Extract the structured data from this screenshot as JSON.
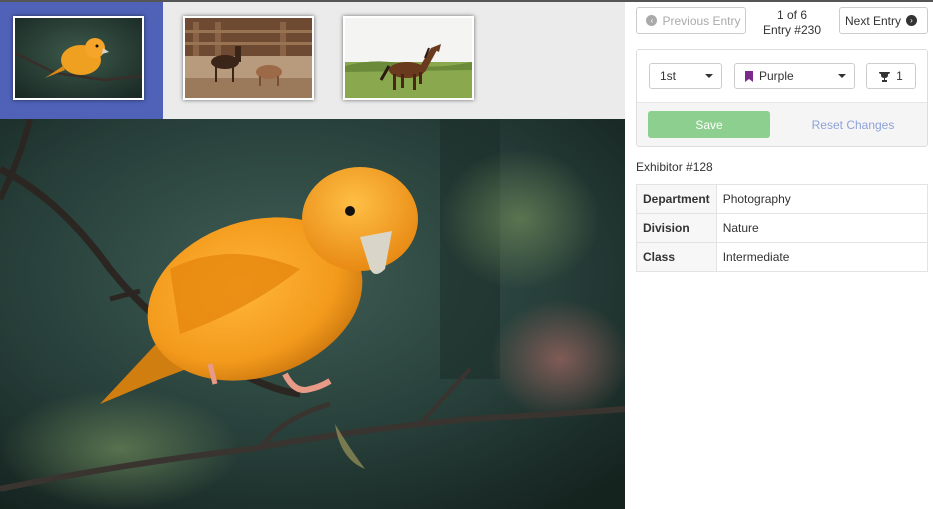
{
  "thumbnails": [
    {
      "name": "canary",
      "active": true
    },
    {
      "name": "foal-and-donkey",
      "active": false
    },
    {
      "name": "running-horse",
      "active": false
    }
  ],
  "nav": {
    "previous_label": "Previous Entry",
    "next_label": "Next Entry",
    "position": "1 of 6",
    "entry": "Entry #230"
  },
  "award": {
    "place": "1st",
    "ribbon": "Purple",
    "ribbon_color": "#7b2a8c",
    "trophy_count": "1",
    "save_label": "Save",
    "reset_label": "Reset Changes"
  },
  "exhibitor": "Exhibitor #128",
  "details": [
    {
      "label": "Department",
      "value": "Photography"
    },
    {
      "label": "Division",
      "value": "Nature"
    },
    {
      "label": "Class",
      "value": "Intermediate"
    }
  ],
  "colors": {
    "active_thumb_bg": "#4f62b8",
    "save_button": "#8dcf8e",
    "reset_link": "#8fa2d9"
  },
  "icons": {
    "previous": "chevron-left-circle-icon",
    "next": "chevron-right-circle-icon",
    "ribbon": "bookmark-icon",
    "trophy": "trophy-icon"
  }
}
